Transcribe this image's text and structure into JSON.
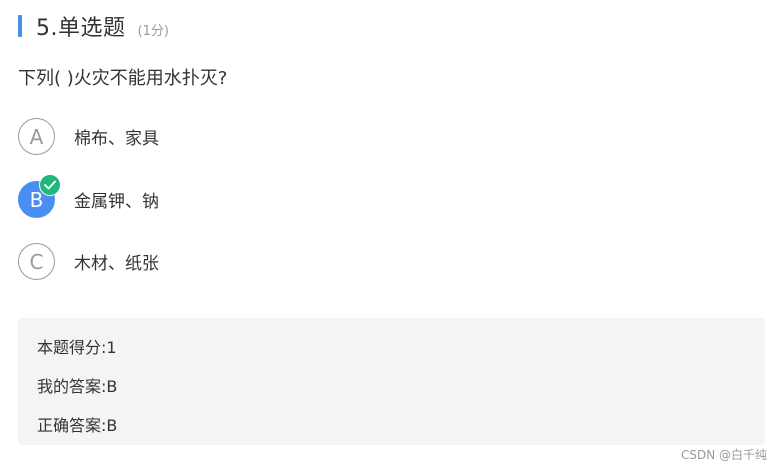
{
  "question": {
    "title": "5.单选题",
    "score": "(1分)",
    "stem": "下列( )火灾不能用水扑灭?",
    "options": [
      {
        "letter": "A",
        "text": "棉布、家具",
        "selected": false
      },
      {
        "letter": "B",
        "text": "金属钾、钠",
        "selected": true
      },
      {
        "letter": "C",
        "text": "木材、纸张",
        "selected": false
      }
    ]
  },
  "result": {
    "score_line": "本题得分:1",
    "my_answer_line": "我的答案:B",
    "correct_answer_line": "正确答案:B"
  },
  "watermark": "CSDN @白千纯",
  "colors": {
    "accent": "#4a90e2",
    "selected": "#4a8ff0",
    "correct_check": "#1fb87a",
    "result_bg": "#f4f4f4"
  },
  "icons": {
    "check": "check-icon"
  }
}
